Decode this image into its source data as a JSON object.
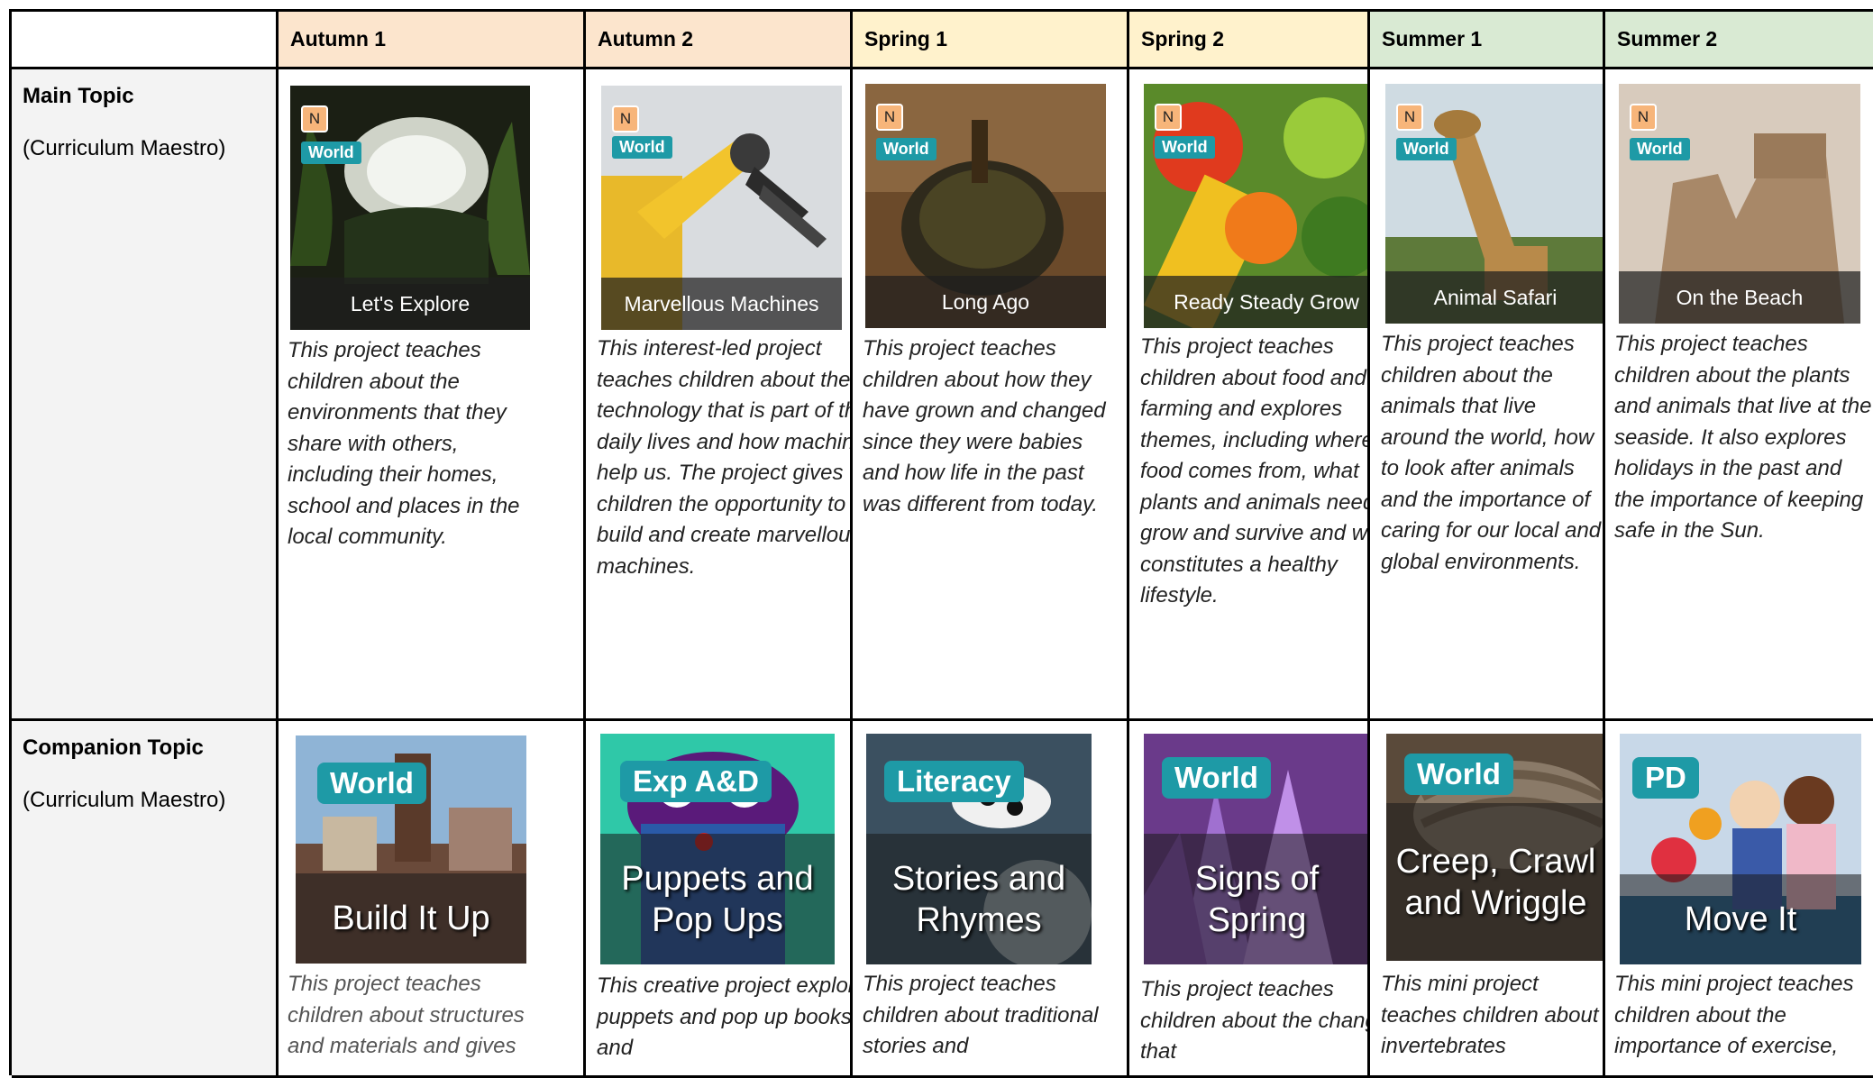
{
  "header": {
    "corner": "",
    "terms": [
      "Autumn 1",
      "Autumn 2",
      "Spring 1",
      "Spring 2",
      "Summer 1",
      "Summer 2"
    ]
  },
  "colors": {
    "autumn": "#fce5cd",
    "spring": "#fff2cc",
    "summer": "#d9ead3",
    "tag_teal": "#1e9aa6",
    "tag_n": "#f7b57a"
  },
  "rows": [
    {
      "title": "Main Topic",
      "subtitle": "(Curriculum Maestro)",
      "cards": [
        {
          "n": "N",
          "tag": "World",
          "title": "Let's Explore",
          "icon": "cave-photo",
          "desc": "This project teaches children about the environments that they share with others, including their homes, school and places in the local community."
        },
        {
          "n": "N",
          "tag": "World",
          "title": "Marvellous Machines",
          "icon": "robot-arm-photo",
          "desc": "This interest-led project teaches children about the technology that is part of their daily lives and how machines help us. The project gives children the opportunity to build and create marvellous machines."
        },
        {
          "n": "N",
          "tag": "World",
          "title": "Long Ago",
          "icon": "spinning-top-photo",
          "desc": "This project teaches children about how they have grown and changed since they were babies and how life in the past was different from today."
        },
        {
          "n": "N",
          "tag": "World",
          "title": "Ready Steady Grow",
          "icon": "vegetables-photo",
          "desc": "This project teaches children about food and farming and explores themes, including where food comes from, what plants and animals need to grow and survive and what constitutes a healthy lifestyle."
        },
        {
          "n": "N",
          "tag": "World",
          "title": "Animal Safari",
          "icon": "giraffe-photo",
          "desc": "This project teaches children about the animals that live around the world, how to look after animals and the importance of caring for our local and global environments."
        },
        {
          "n": "N",
          "tag": "World",
          "title": "On the Beach",
          "icon": "sandcastle-photo",
          "desc": "This project teaches children about the plants and animals that live at the seaside. It also explores holidays in the past and the importance of keeping safe in the Sun."
        }
      ]
    },
    {
      "title": "Companion Topic",
      "subtitle": "(Curriculum Maestro)",
      "cards": [
        {
          "tag": "World",
          "title": "Build It Up",
          "icon": "city-buildings-photo",
          "desc": "This project teaches children about structures and materials and gives"
        },
        {
          "tag": "Exp A&D",
          "title": "Puppets and Pop Ups",
          "icon": "sock-puppet-photo",
          "desc": "This creative project explores puppets and pop up books and"
        },
        {
          "tag": "Literacy",
          "title": "Stories and Rhymes",
          "icon": "cow-moon-photo",
          "desc": "This project teaches children about traditional stories and"
        },
        {
          "tag": "World",
          "title": "Signs of Spring",
          "icon": "crocus-flowers-photo",
          "desc": "This project teaches children about the changes that"
        },
        {
          "tag": "World",
          "title": "Creep, Crawl and Wriggle",
          "icon": "woodlouse-photo",
          "desc": "This mini project teaches children about invertebrates"
        },
        {
          "tag": "PD",
          "title": "Move It",
          "icon": "children-exercise-photo",
          "desc": "This mini project teaches children about the importance of exercise,"
        }
      ]
    }
  ]
}
